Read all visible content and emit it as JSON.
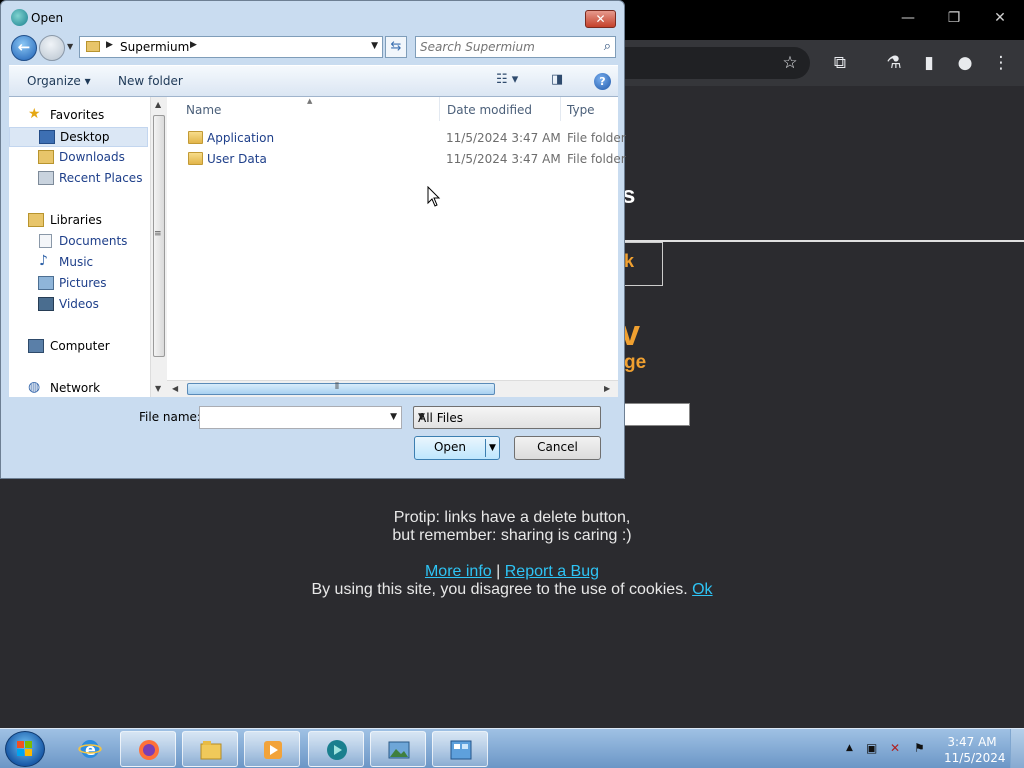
{
  "browser": {
    "page_heading_fragment": "s",
    "box_fragment": "k",
    "big_fragment": "v",
    "sub_fragment": "ge",
    "protip_line1": "Protip: links have a delete button,",
    "protip_line2": "but remember: sharing is caring :)",
    "more_info": "More info",
    "separator": "|",
    "report_bug": "Report a Bug",
    "cookie_text": "By using this site, you disagree to the use of cookies.",
    "cookie_ok": "Ok"
  },
  "dialog": {
    "title": "Open",
    "close_label": "✕",
    "address": {
      "segments": [
        "Supermium"
      ]
    },
    "search_placeholder": "Search Supermium",
    "commands": {
      "organize": "Organize",
      "new_folder": "New folder"
    },
    "nav": {
      "favorites": "Favorites",
      "favorites_items": [
        "Desktop",
        "Downloads",
        "Recent Places"
      ],
      "libraries": "Libraries",
      "libraries_items": [
        "Documents",
        "Music",
        "Pictures",
        "Videos"
      ],
      "computer": "Computer",
      "network": "Network"
    },
    "columns": {
      "name": "Name",
      "date": "Date modified",
      "type": "Type"
    },
    "files": [
      {
        "name": "Application",
        "date": "11/5/2024 3:47 AM",
        "type": "File folder"
      },
      {
        "name": "User Data",
        "date": "11/5/2024 3:47 AM",
        "type": "File folder"
      }
    ],
    "file_name_label": "File name:",
    "file_name_value": "",
    "filter_value": "All Files",
    "open_label": "Open",
    "cancel_label": "Cancel"
  },
  "taskbar": {
    "time": "3:47 AM",
    "date": "11/5/2024"
  },
  "colors": {
    "accent_orange": "#f0a030",
    "link_blue": "#2ec4f5",
    "nav_link": "#1e3f8a"
  }
}
